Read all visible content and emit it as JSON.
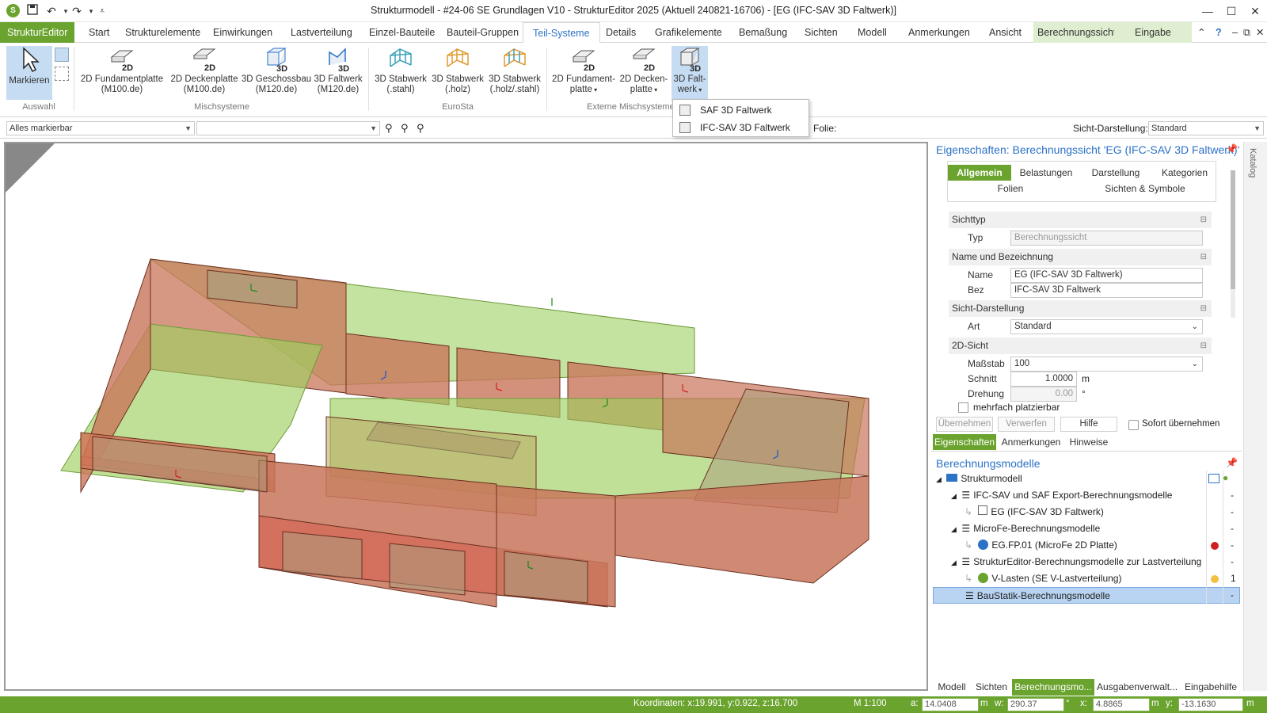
{
  "window": {
    "title": "Strukturmodell - #24-06 SE Grundlagen V10 - StrukturEditor 2025 (Aktuell 240821-16706) - [EG (IFC-SAV 3D Faltwerk)]"
  },
  "menu": {
    "app": "StrukturEditor",
    "tabs": [
      "Start",
      "Strukturelemente",
      "Einwirkungen",
      "Lastverteilung",
      "Einzel-Bauteile",
      "Bauteil-Gruppen",
      "Teil-Systeme",
      "Details",
      "Grafikelemente",
      "Bemaßung",
      "Sichten",
      "Modell",
      "Anmerkungen",
      "Ansicht",
      "Berechnungssicht",
      "Eingabe"
    ]
  },
  "ribbon": {
    "buttons": [
      {
        "l1": "Markieren",
        "l2": ""
      },
      {
        "l1": "2D Fundamentplatte",
        "l2": "(M100.de)"
      },
      {
        "l1": "2D Deckenplatte",
        "l2": "(M100.de)"
      },
      {
        "l1": "3D Geschossbau",
        "l2": "(M120.de)"
      },
      {
        "l1": "3D Faltwerk",
        "l2": "(M120.de)"
      },
      {
        "l1": "3D Stabwerk",
        "l2": "(.stahl)"
      },
      {
        "l1": "3D Stabwerk",
        "l2": "(.holz)"
      },
      {
        "l1": "3D Stabwerk",
        "l2": "(.holz/.stahl)"
      },
      {
        "l1": "2D Fundament-",
        "l2": "platte"
      },
      {
        "l1": "2D Decken-",
        "l2": "platte"
      },
      {
        "l1": "3D Falt-",
        "l2": "werk"
      }
    ],
    "groups": [
      "Auswahl",
      "Mischsysteme",
      "EuroSta",
      "Externe Mischsysteme"
    ],
    "dropdown": [
      "SAF 3D Faltwerk",
      "IFC-SAV 3D Faltwerk"
    ]
  },
  "toolbar": {
    "filter": "Alles markierbar",
    "folie": "Folie:",
    "sicht_label": "Sicht-Darstellung:",
    "sicht_value": "Standard"
  },
  "properties": {
    "title": "Eigenschaften: Berechnungssicht 'EG (IFC-SAV 3D Faltwerk)'",
    "tabs": [
      "Allgemein",
      "Belastungen",
      "Darstellung",
      "Kategorien",
      "Folien",
      "Sichten & Symbole"
    ],
    "sections": {
      "sichttyp": "Sichttyp",
      "name": "Name und Bezeichnung",
      "darstellung": "Sicht-Darstellung",
      "sicht2d": "2D-Sicht"
    },
    "fields": {
      "typ_label": "Typ",
      "typ_value": "Berechnungssicht",
      "name_label": "Name",
      "name_value": "EG (IFC-SAV 3D Faltwerk)",
      "bez_label": "Bez",
      "bez_value": "IFC-SAV 3D Faltwerk",
      "art_label": "Art",
      "art_value": "Standard",
      "massstab_label": "Maßstab",
      "massstab_value": "100",
      "schnitt_label": "Schnitt",
      "schnitt_value": "1.0000",
      "schnitt_unit": "m",
      "drehung_label": "Drehung",
      "drehung_value": "0.00",
      "drehung_unit": "°",
      "mehrfach": "mehrfach platzierbar"
    },
    "buttons": {
      "uebernehmen": "Übernehmen",
      "verwerfen": "Verwerfen",
      "hilfe": "Hilfe",
      "sofort": "Sofort übernehmen"
    },
    "subtabs": [
      "Eigenschaften",
      "Anmerkungen",
      "Hinweise"
    ]
  },
  "models": {
    "title": "Berechnungsmodelle",
    "tree": [
      {
        "label": "Strukturmodell",
        "status": ""
      },
      {
        "label": "IFC-SAV und SAF Export-Berechnungsmodelle",
        "status": "-"
      },
      {
        "label": "EG (IFC-SAV 3D Faltwerk)",
        "status": "-"
      },
      {
        "label": "MicroFe-Berechnungsmodelle",
        "status": "-"
      },
      {
        "label": "EG.FP.01 (MicroFe 2D Platte)",
        "status": "-"
      },
      {
        "label": "StrukturEditor-Berechnungsmodelle zur Lastverteilung",
        "status": "-"
      },
      {
        "label": "V-Lasten (SE V-Lastverteilung)",
        "status": "1"
      },
      {
        "label": "BauStatik-Berechnungsmodelle",
        "status": "-"
      }
    ]
  },
  "bottom_tabs": [
    "Modell",
    "Sichten",
    "Berechnungsmo...",
    "Ausgabenverwalt...",
    "Eingabehilfe"
  ],
  "catalog": "Katalog",
  "status": {
    "koordinaten": "Koordinaten: x:19.991, y:0.922, z:16.700",
    "scale": "M 1:100",
    "a_label": "a:",
    "a_value": "14.0408",
    "a_unit": "m",
    "w_label": "w:",
    "w_value": "290.37",
    "w_unit": "°",
    "x_label": "x:",
    "x_value": "4.8865",
    "x_unit": "m",
    "y_label": "y:",
    "y_value": "-13.1630",
    "y_unit": "m"
  },
  "colors": {
    "accent": "#6aa32e",
    "link": "#2c72c7",
    "wall": "#c8755a",
    "slab": "#9ed060"
  }
}
